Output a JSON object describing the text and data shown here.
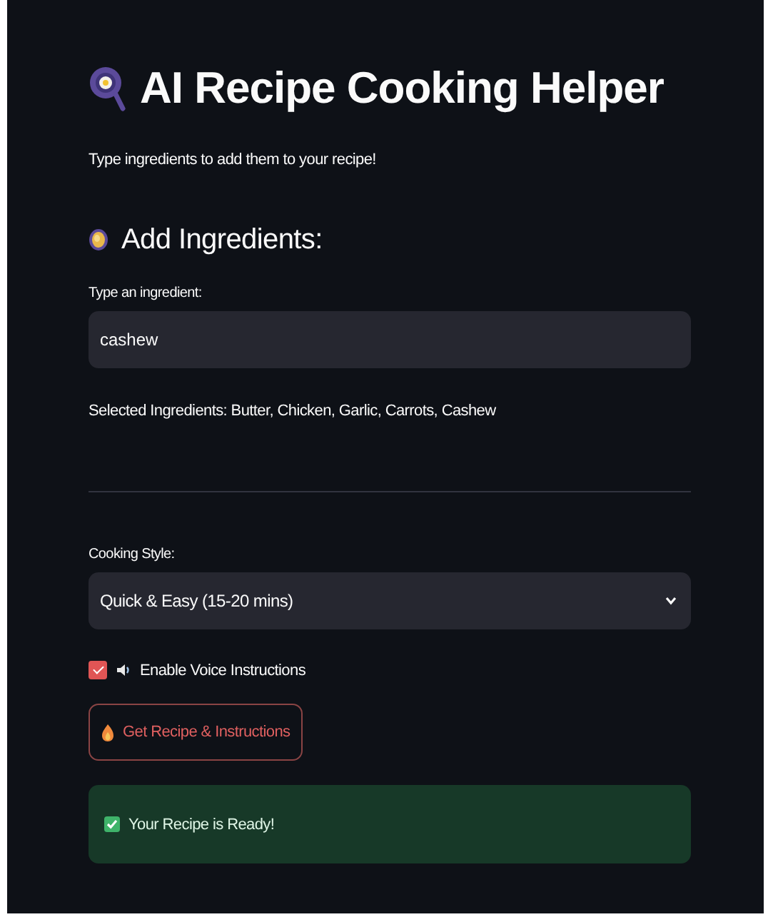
{
  "title": "AI Recipe Cooking Helper",
  "subtitle": "Type ingredients to add them to your recipe!",
  "section_heading": "Add Ingredients:",
  "ingredient_field": {
    "label": "Type an ingredient:",
    "value": "cashew"
  },
  "selected_ingredients": "Selected Ingredients: Butter, Chicken, Garlic, Carrots, Cashew",
  "cooking_style": {
    "label": "Cooking Style:",
    "value": "Quick & Easy (15-20 mins)"
  },
  "voice_checkbox": {
    "label": "Enable Voice Instructions",
    "checked": true
  },
  "action_button": {
    "label": "Get Recipe & Instructions"
  },
  "alert": {
    "kind": "success",
    "text": "Your Recipe is Ready!"
  }
}
